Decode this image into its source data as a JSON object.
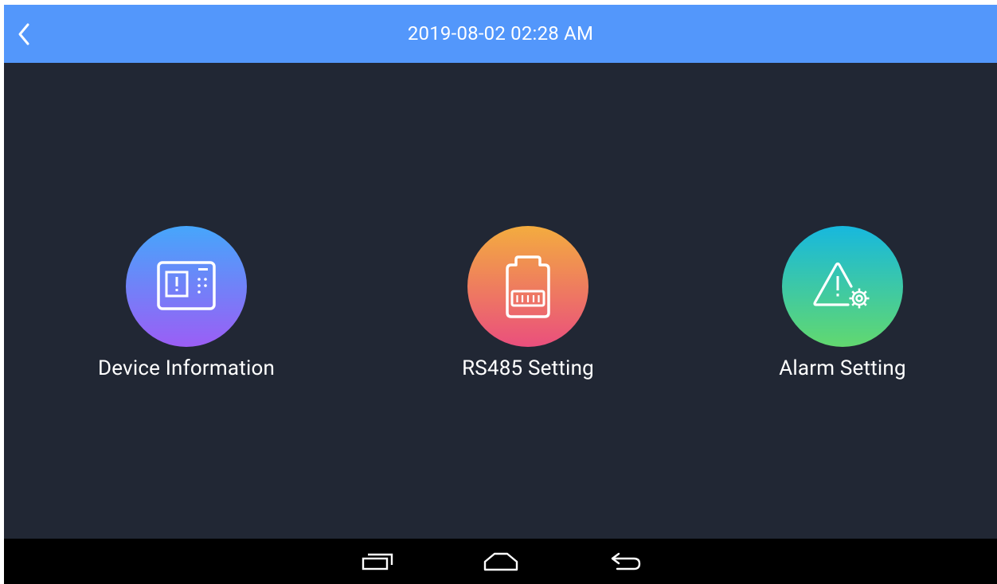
{
  "header": {
    "datetime": "2019-08-02 02:28 AM",
    "back_icon": "chevron-left-icon",
    "background_color": "#5397fb"
  },
  "menu": [
    {
      "label": "Device Information",
      "icon": "device-panel-icon",
      "gradient": [
        "#46a6fb",
        "#9b5ef5"
      ]
    },
    {
      "label": "RS485 Setting",
      "icon": "ethernet-port-icon",
      "gradient": [
        "#f3ac3f",
        "#ea4f7d"
      ]
    },
    {
      "label": "Alarm Setting",
      "icon": "alarm-warning-gear-icon",
      "gradient": [
        "#17b8de",
        "#62d86f"
      ]
    }
  ],
  "system_nav": {
    "recent_icon": "recent-apps-icon",
    "home_icon": "home-icon",
    "back_icon": "back-arrow-icon"
  },
  "colors": {
    "screen_background": "#212734",
    "nav_background": "#000000"
  }
}
